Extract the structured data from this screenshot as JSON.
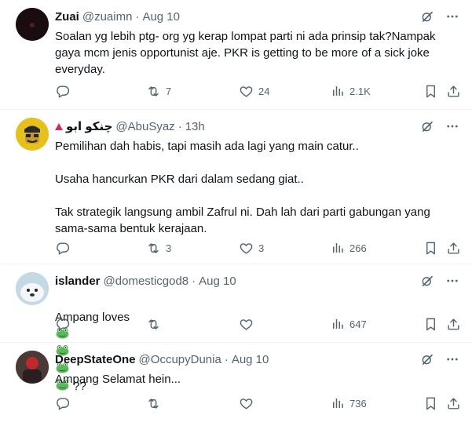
{
  "tweets": [
    {
      "name": "Zuai",
      "handle": "@zuaimn",
      "dot": "·",
      "time": "Aug 10",
      "text": "Soalan yg lebih ptg- org yg kerap lompat parti ni ada prinsip tak?Nampak gaya mcm jenis opportunist aje. PKR is getting to be more of a sick joke everyday.",
      "reply_count": "",
      "retweet_count": "7",
      "like_count": "24",
      "view_count": "2.1K"
    },
    {
      "name": "چنکو ابو",
      "handle": "@AbuSyaz",
      "dot": "·",
      "time": "13h",
      "text": "Pemilihan dah habis, tapi masih ada lagi yang main catur..\n\nUsaha hancurkan PKR dari dalam sedang giat..\n\nTak strategik langsung ambil Zafrul ni. Dah lah dari parti gabungan yang sama-sama bentuk kerajaan.",
      "reply_count": "",
      "retweet_count": "3",
      "like_count": "3",
      "view_count": "266"
    },
    {
      "name": "islander",
      "handle": "@domesticgod8",
      "dot": "·",
      "time": "Aug 10",
      "text": "Ampang loves",
      "text_suffix": " ??",
      "reply_count": "",
      "retweet_count": "",
      "like_count": "",
      "view_count": "647"
    },
    {
      "name": "DeepStateOne",
      "handle": "@OccupyDunia",
      "dot": "·",
      "time": "Aug 10",
      "text": "Ampang Selamat hein...",
      "reply_count": "",
      "retweet_count": "",
      "like_count": "",
      "view_count": "736"
    }
  ],
  "colors": {
    "text_primary": "#0f1419",
    "text_secondary": "#536471",
    "divider": "#eff3f4",
    "badge": "#e0245e"
  },
  "icons": [
    "grok-icon",
    "more-icon",
    "reply-icon",
    "retweet-icon",
    "like-icon",
    "views-icon",
    "bookmark-icon",
    "share-icon",
    "frog-emoji"
  ]
}
